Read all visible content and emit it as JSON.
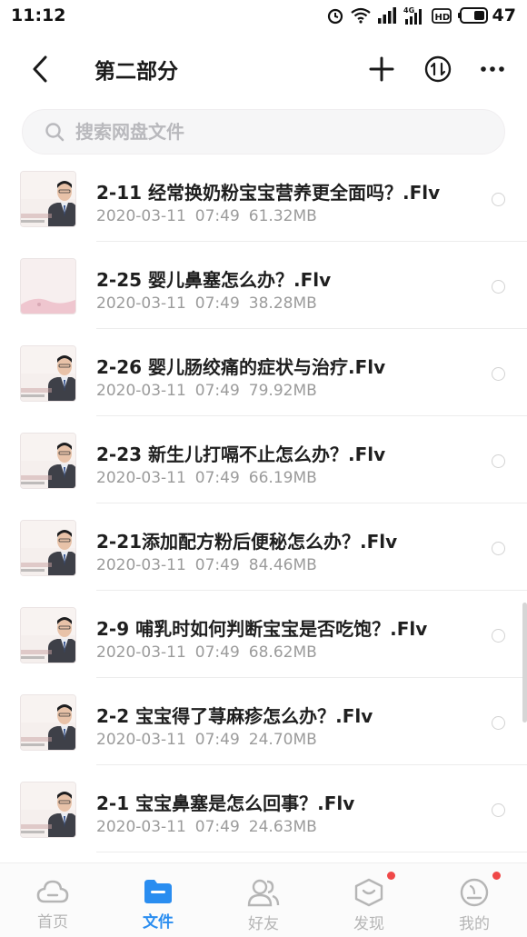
{
  "status_bar": {
    "time": "11:12",
    "battery": "47",
    "network_label": "4G",
    "hd_label": "HD"
  },
  "header": {
    "title": "第二部分",
    "back_icon": "chevron-left-icon",
    "add_icon": "plus-icon",
    "sort_icon": "sort-arrows-icon",
    "more_icon": "more-dots-icon"
  },
  "search": {
    "placeholder": "搜索网盘文件"
  },
  "files": [
    {
      "name": "2-11 经常换奶粉宝宝营养更全面吗？.Flv",
      "date": "2020-03-11",
      "time": "07:49",
      "size": "61.32MB",
      "thumb": "lecturer"
    },
    {
      "name": "2-25 婴儿鼻塞怎么办？.Flv",
      "date": "2020-03-11",
      "time": "07:49",
      "size": "38.28MB",
      "thumb": "blank"
    },
    {
      "name": "2-26 婴儿肠绞痛的症状与治疗.Flv",
      "date": "2020-03-11",
      "time": "07:49",
      "size": "79.92MB",
      "thumb": "lecturer"
    },
    {
      "name": "2-23 新生儿打嗝不止怎么办？.Flv",
      "date": "2020-03-11",
      "time": "07:49",
      "size": "66.19MB",
      "thumb": "lecturer"
    },
    {
      "name": "2-21添加配方粉后便秘怎么办？.Flv",
      "date": "2020-03-11",
      "time": "07:49",
      "size": "84.46MB",
      "thumb": "lecturer"
    },
    {
      "name": "2-9 哺乳时如何判断宝宝是否吃饱？.Flv",
      "date": "2020-03-11",
      "time": "07:49",
      "size": "68.62MB",
      "thumb": "lecturer"
    },
    {
      "name": "2-2 宝宝得了荨麻疹怎么办？.Flv",
      "date": "2020-03-11",
      "time": "07:49",
      "size": "24.70MB",
      "thumb": "lecturer"
    },
    {
      "name": "2-1 宝宝鼻塞是怎么回事？.Flv",
      "date": "2020-03-11",
      "time": "07:49",
      "size": "24.63MB",
      "thumb": "lecturer"
    }
  ],
  "bottom_nav": [
    {
      "label": "首页",
      "icon": "cloud-icon",
      "active": false,
      "badge": false
    },
    {
      "label": "文件",
      "icon": "folder-icon",
      "active": true,
      "badge": false
    },
    {
      "label": "好友",
      "icon": "friends-icon",
      "active": false,
      "badge": false
    },
    {
      "label": "发现",
      "icon": "discover-icon",
      "active": false,
      "badge": true
    },
    {
      "label": "我的",
      "icon": "profile-icon",
      "active": false,
      "badge": true
    }
  ],
  "colors": {
    "accent": "#2a8df0",
    "badge": "#f04848",
    "inactive": "#b5b5b5"
  }
}
